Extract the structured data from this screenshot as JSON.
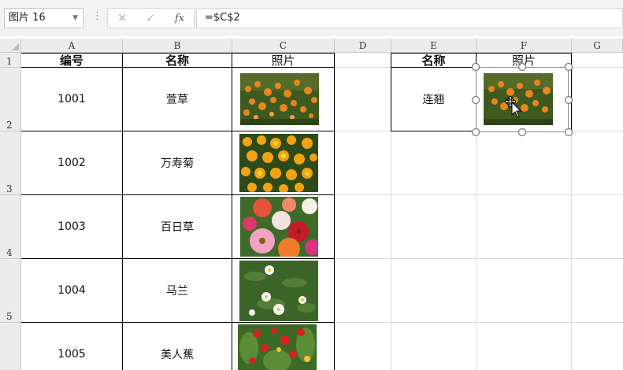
{
  "formula_bar": {
    "name_box": "图片 16",
    "cancel_icon": "✕",
    "enter_icon": "✓",
    "fx_label": "fx",
    "formula": "=$C$2"
  },
  "columns": [
    "A",
    "B",
    "C",
    "D",
    "E",
    "F",
    "G"
  ],
  "rows": [
    "1",
    "2",
    "3",
    "4",
    "5"
  ],
  "table1": {
    "headers": [
      "编号",
      "名称",
      "照片"
    ],
    "rows": [
      {
        "id": "1001",
        "name": "萱草",
        "photo": "daylily"
      },
      {
        "id": "1002",
        "name": "万寿菊",
        "photo": "marigold"
      },
      {
        "id": "1003",
        "name": "百日草",
        "photo": "zinnia"
      },
      {
        "id": "1004",
        "name": "马兰",
        "photo": "aster"
      },
      {
        "id": "1005",
        "name": "美人蕉",
        "photo": "canna"
      }
    ]
  },
  "table2": {
    "headers": [
      "名称",
      "照片"
    ],
    "row": {
      "name": "连翘",
      "photo": "linked-picture"
    }
  },
  "colors": {
    "grid": "#dadada",
    "header_bg": "#ececec",
    "selection_handle": "#777777"
  }
}
